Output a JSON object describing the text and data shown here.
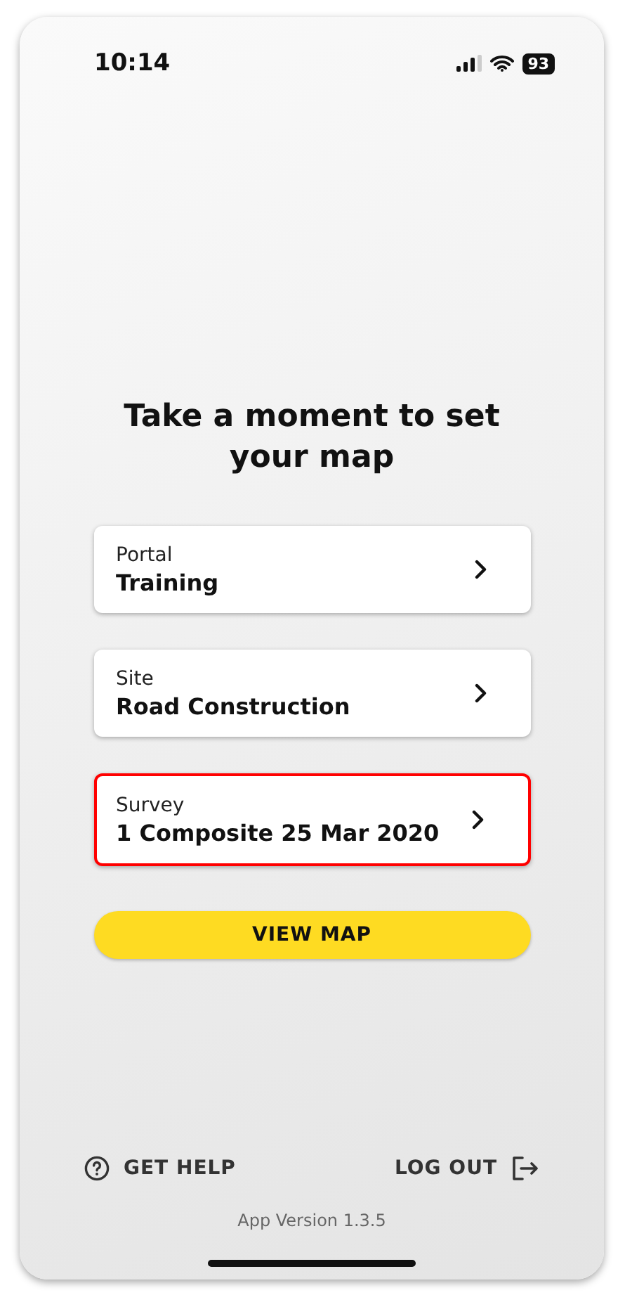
{
  "status_bar": {
    "time": "10:14",
    "battery": "93"
  },
  "title": "Take a moment to set your map",
  "selectors": [
    {
      "label": "Portal",
      "value": "Training",
      "selected": false
    },
    {
      "label": "Site",
      "value": "Road Construction",
      "selected": false
    },
    {
      "label": "Survey",
      "value": "1 Composite 25 Mar 2020",
      "selected": true
    }
  ],
  "primary_button": "VIEW MAP",
  "footer": {
    "help": "GET HELP",
    "logout": "LOG OUT"
  },
  "version": "App Version 1.3.5"
}
